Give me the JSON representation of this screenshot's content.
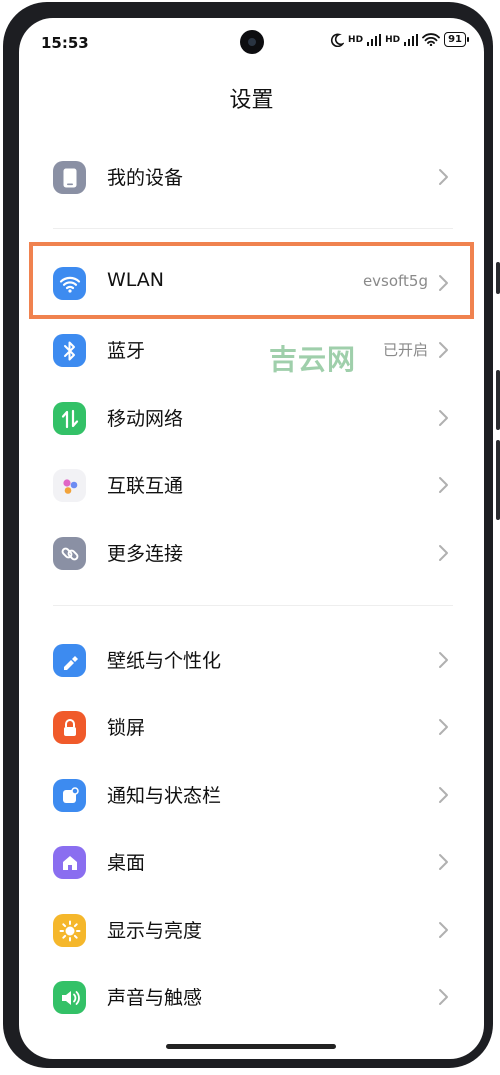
{
  "status": {
    "time": "15:53",
    "signal1": "HD",
    "signal2": "HD",
    "battery": "91"
  },
  "title": "设置",
  "watermark": "吉云网",
  "sections": [
    {
      "items": [
        {
          "label": "我的设备",
          "value": "",
          "icon": "phone-icon",
          "color": "#8a90a4"
        }
      ]
    },
    {
      "items": [
        {
          "label": "WLAN",
          "value": "evsoft5g",
          "icon": "wifi-icon",
          "color": "#3d8bf0"
        },
        {
          "label": "蓝牙",
          "value": "已开启",
          "icon": "bluetooth-icon",
          "color": "#3d8bf0"
        },
        {
          "label": "移动网络",
          "value": "",
          "icon": "mobile-data-icon",
          "color": "#33c167"
        },
        {
          "label": "互联互通",
          "value": "",
          "icon": "interconnect-icon",
          "color": "#f2f2f5"
        },
        {
          "label": "更多连接",
          "value": "",
          "icon": "link-icon",
          "color": "#8a90a4"
        }
      ]
    },
    {
      "items": [
        {
          "label": "壁纸与个性化",
          "value": "",
          "icon": "brush-icon",
          "color": "#3d8bf0"
        },
        {
          "label": "锁屏",
          "value": "",
          "icon": "lock-icon",
          "color": "#f05a2a"
        },
        {
          "label": "通知与状态栏",
          "value": "",
          "icon": "notification-icon",
          "color": "#3d8bf0"
        },
        {
          "label": "桌面",
          "value": "",
          "icon": "home-icon",
          "color": "#8a6ef0"
        },
        {
          "label": "显示与亮度",
          "value": "",
          "icon": "sun-icon",
          "color": "#f5b72b"
        },
        {
          "label": "声音与触感",
          "value": "",
          "icon": "speaker-icon",
          "color": "#33c167"
        }
      ]
    }
  ]
}
